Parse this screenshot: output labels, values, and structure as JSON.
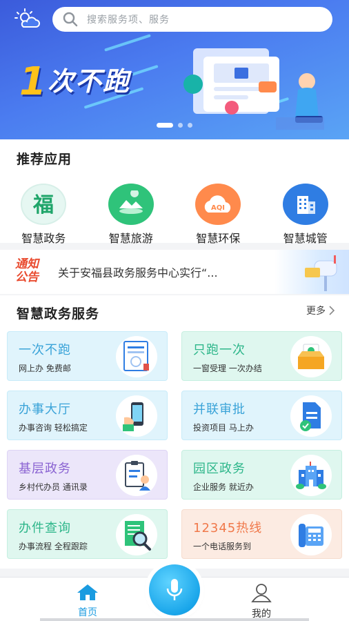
{
  "search": {
    "placeholder": "搜索服务项、服务"
  },
  "banner": {
    "slogan_number": "1",
    "slogan_text": "次不跑",
    "active_slide": 1,
    "slide_count": 3
  },
  "recommended": {
    "title": "推荐应用",
    "apps": [
      {
        "label": "智慧政务",
        "icon": "fu-icon"
      },
      {
        "label": "智慧旅游",
        "icon": "travel-icon"
      },
      {
        "label": "智慧环保",
        "icon": "aqi-icon"
      },
      {
        "label": "智慧城管",
        "icon": "building-icon"
      }
    ]
  },
  "notice": {
    "badge_line1": "通知",
    "badge_line2": "公告",
    "text": "关于安福县政务服务中心实行“..."
  },
  "services": {
    "title": "智慧政务服务",
    "more_label": "更多",
    "cards": [
      {
        "title": "一次不跑",
        "subtitle": "网上办 免费邮",
        "icon": "certificate-icon",
        "bg": "#e0f4fc",
        "border": "#c7ebf9",
        "color": "#3aa3d8"
      },
      {
        "title": "只跑一次",
        "subtitle": "一窗受理 一次办结",
        "icon": "inbox-check-icon",
        "bg": "#dff7ef",
        "border": "#c5efe0",
        "color": "#2db68a"
      },
      {
        "title": "办事大厅",
        "subtitle": "办事咨询 轻松搞定",
        "icon": "phone-hand-icon",
        "bg": "#e0f4fc",
        "border": "#c7ebf9",
        "color": "#3aa3d8"
      },
      {
        "title": "并联审批",
        "subtitle": "投资项目 马上办",
        "icon": "document-check-icon",
        "bg": "#e0f4fc",
        "border": "#c7ebf9",
        "color": "#3aa3d8"
      },
      {
        "title": "基层政务",
        "subtitle": "乡村代办员 通讯录",
        "icon": "clipboard-person-icon",
        "bg": "#ece6fa",
        "border": "#ddd3f5",
        "color": "#8a63d2"
      },
      {
        "title": "园区政务",
        "subtitle": "企业服务 就近办",
        "icon": "park-building-icon",
        "bg": "#dff7ef",
        "border": "#c5efe0",
        "color": "#2db68a"
      },
      {
        "title": "办件查询",
        "subtitle": "办事流程 全程跟踪",
        "icon": "magnifier-doc-icon",
        "bg": "#dff7ef",
        "border": "#c5efe0",
        "color": "#2db68a"
      },
      {
        "title": "12345热线",
        "subtitle": "一个电话服务到",
        "icon": "telephone-icon",
        "bg": "#fcebe2",
        "border": "#f6dccd",
        "color": "#f0784a"
      }
    ]
  },
  "nav": {
    "tabs": [
      {
        "label": "首页",
        "icon": "home-icon",
        "active": true
      },
      {
        "label": "我的",
        "icon": "user-icon",
        "active": false
      }
    ],
    "center_icon": "microphone-icon",
    "active_color": "#1a9be0"
  }
}
